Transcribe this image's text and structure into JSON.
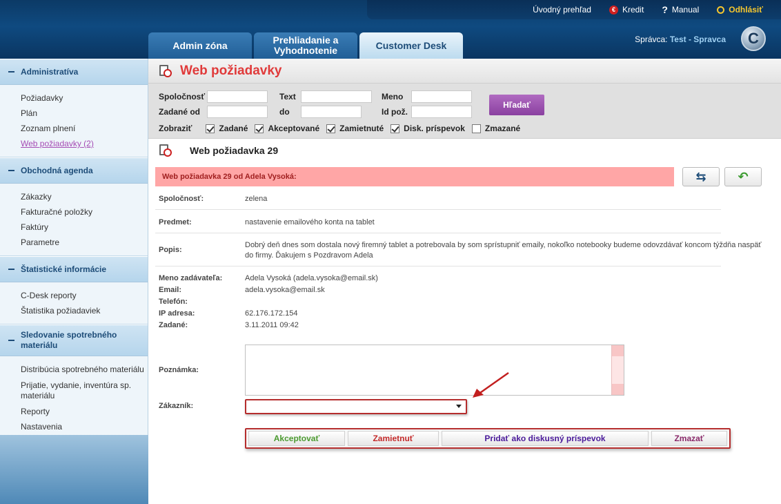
{
  "topbar": {
    "links": [
      {
        "label": "Úvodný prehľad"
      },
      {
        "label": "Kredit"
      },
      {
        "label": "Manual"
      },
      {
        "label": "Odhlásiť"
      }
    ]
  },
  "tabs": [
    {
      "label": "Admin zóna"
    },
    {
      "label": "Prehliadanie a Vyhodnotenie"
    },
    {
      "label": "Customer Desk"
    }
  ],
  "admin": {
    "prefix": "Správca:",
    "name": "Test - Spravca"
  },
  "sidebar": {
    "sections": [
      {
        "title": "Administratíva",
        "items": [
          "Požiadavky",
          "Plán",
          "Zoznam plnení"
        ],
        "active_item": "Web požiadavky",
        "active_count": "(2)"
      },
      {
        "title": "Obchodná agenda",
        "items": [
          "Zákazky",
          "Fakturačné položky",
          "Faktúry",
          "Parametre"
        ]
      },
      {
        "title": "Štatistické informácie",
        "items": [
          "C-Desk reporty",
          "Štatistika požiadaviek"
        ]
      },
      {
        "title": "Sledovanie spotrebného materiálu",
        "items": [
          "Distribúcia spotrebného materiálu",
          "Prijatie, vydanie, inventúra sp. materiálu",
          "Reporty",
          "Nastavenia"
        ]
      }
    ]
  },
  "page": {
    "title": "Web požiadavky"
  },
  "filter": {
    "labels": {
      "company": "Spoločnosť",
      "text": "Text",
      "name": "Meno",
      "from": "Zadané od",
      "to": "do",
      "id": "Id pož.",
      "show": "Zobraziť"
    },
    "search_label": "Hľadať",
    "checks": [
      {
        "label": "Zadané",
        "checked": true
      },
      {
        "label": "Akceptované",
        "checked": true
      },
      {
        "label": "Zamietnuté",
        "checked": true
      },
      {
        "label": "Disk. príspevok",
        "checked": true
      },
      {
        "label": "Zmazané",
        "checked": false
      }
    ]
  },
  "detail": {
    "title": "Web požiadavka 29",
    "banner": "Web požiadavka 29 od Adela Vysoká:",
    "company_label": "Spoločnosť:",
    "company": "zelena",
    "subject_label": "Predmet:",
    "subject": "nastavenie emailového konta na tablet",
    "desc_label": "Popis:",
    "desc": "Dobrý deň dnes som dostala nový firemný tablet a potrebovala by som sprístupniť emaily, nokoľko notebooky budeme odovzdávať koncom týždňa naspäť do firmy. Ďakujem s Pozdravom Adela",
    "requester_label": "Meno zadávateľa:",
    "requester": "Adela Vysoká (adela.vysoka@email.sk)",
    "email_label": "Email:",
    "email": "adela.vysoka@email.sk",
    "phone_label": "Telefón:",
    "phone": "",
    "ip_label": "IP adresa:",
    "ip": "62.176.172.154",
    "date_label": "Zadané:",
    "date": "3.11.2011 09:42",
    "note_label": "Poznámka:",
    "customer_label": "Zákazník:"
  },
  "actions": {
    "accept": "Akceptovať",
    "reject": "Zamietnuť",
    "add_disc": "Pridať ako diskusný príspevok",
    "delete": "Zmazať"
  },
  "colors": {
    "accept": "#4a9a2f",
    "reject": "#c42b2b",
    "add_disc": "#4a1a9a",
    "delete": "#8a2a6a",
    "title": "#e03a3a"
  }
}
